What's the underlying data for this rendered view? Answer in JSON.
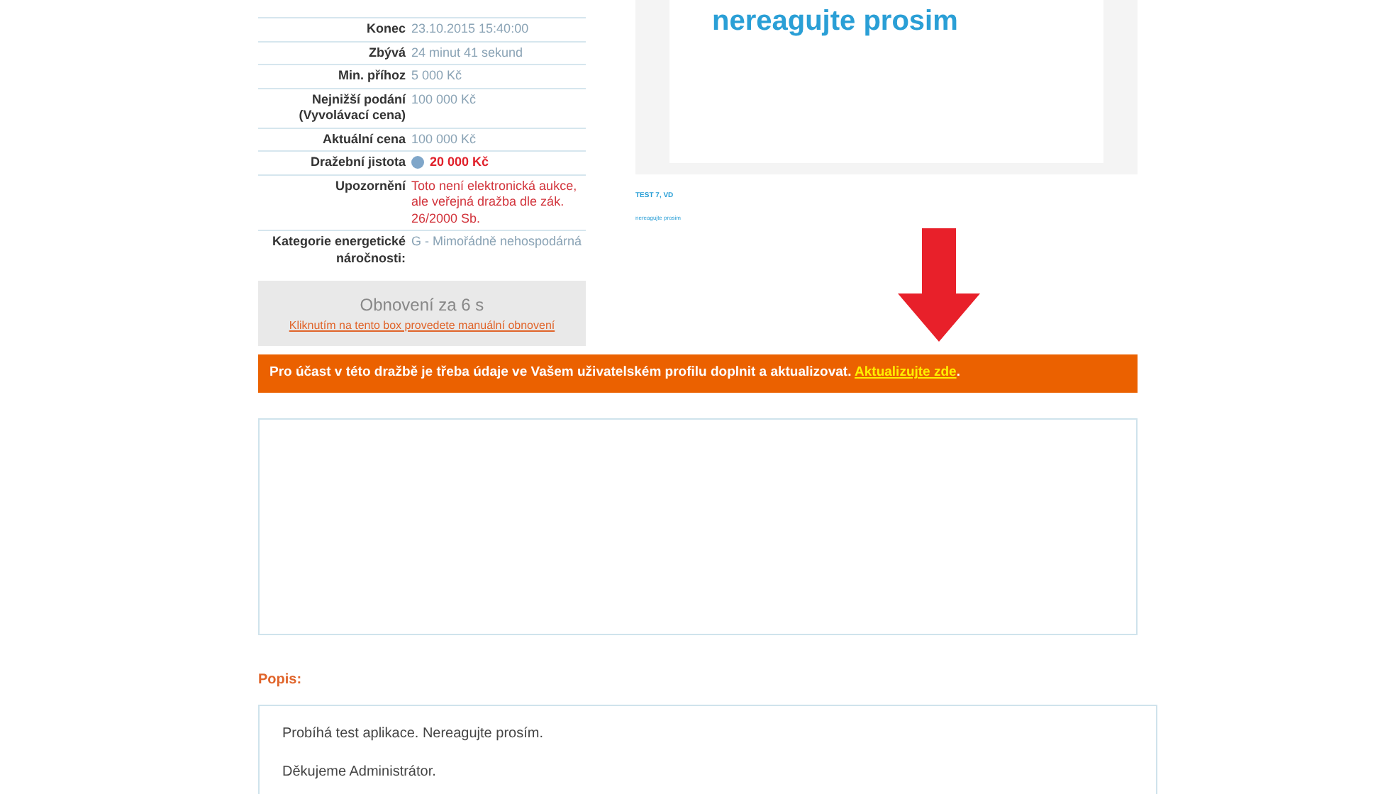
{
  "details": [
    {
      "label": "Konec",
      "value": "23.10.2015 15:40:00",
      "kind": "plain"
    },
    {
      "label": "Zbývá",
      "value": "24 minut 41 sekund",
      "kind": "plain"
    },
    {
      "label": "Min. příhoz",
      "value": "5 000 Kč",
      "kind": "plain"
    },
    {
      "label": "Nejnižší podání (Vyvolávací cena)",
      "value": "100 000 Kč",
      "kind": "plain"
    },
    {
      "label": "Aktuální cena",
      "value": "100 000 Kč",
      "kind": "plain"
    },
    {
      "label": "Dražební jistota",
      "value": "20 000 Kč",
      "kind": "deposit"
    },
    {
      "label": "Upozornění",
      "value": "Toto není elektronická aukce, ale veřejná dražba dle zák. 26/2000 Sb.",
      "kind": "warning"
    },
    {
      "label": "Kategorie energetické náročnosti:",
      "value": "G - Mimořádně nehospodárná",
      "kind": "plain"
    }
  ],
  "refresh": {
    "title": "Obnovení za 6 s",
    "link": "Kliknutím na tento box provedete manuální obnovení"
  },
  "preview": {
    "heading": "nereagujte prosim",
    "caption": "TEST 7, VD",
    "subcaption": "nereagujte prosim"
  },
  "notice": {
    "text": "Pro účast v této dražbě je třeba údaje ve Vašem uživatelském profilu doplnit a aktualizovat.",
    "link": "Aktualizujte zde",
    "end": "."
  },
  "description": {
    "heading": "Popis:",
    "paragraphs": [
      "Probíhá test aplikace. Nereagujte prosím.",
      "Děkujeme Administrátor."
    ]
  }
}
